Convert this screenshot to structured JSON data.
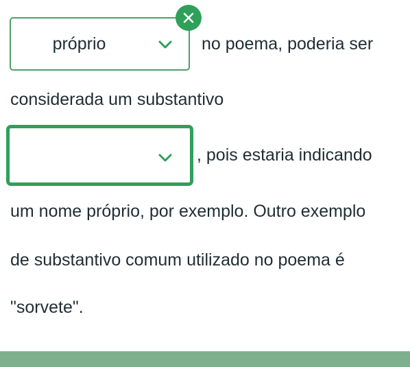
{
  "dropdown_1": {
    "selected_value": "próprio",
    "clear_icon": "close-icon",
    "chevron_icon": "chevron-down-icon",
    "border_color": "#4f9e6b"
  },
  "dropdown_2": {
    "selected_value": "",
    "chevron_icon": "chevron-down-icon",
    "border_color": "#2ea05a"
  },
  "passage": {
    "line_1_after_dropdown": "no poema, poderia ser",
    "line_2": "considerada um substantivo",
    "line_3_after_dropdown": ", pois estaria indicando",
    "line_4": "um nome próprio, por exemplo. Outro exemplo",
    "line_5": "de substantivo comum utilizado no poema é",
    "line_6": "\"sorvete\"."
  },
  "colors": {
    "accent": "#2ea05a",
    "footer": "#7fb08d",
    "text": "#1f2d33"
  }
}
